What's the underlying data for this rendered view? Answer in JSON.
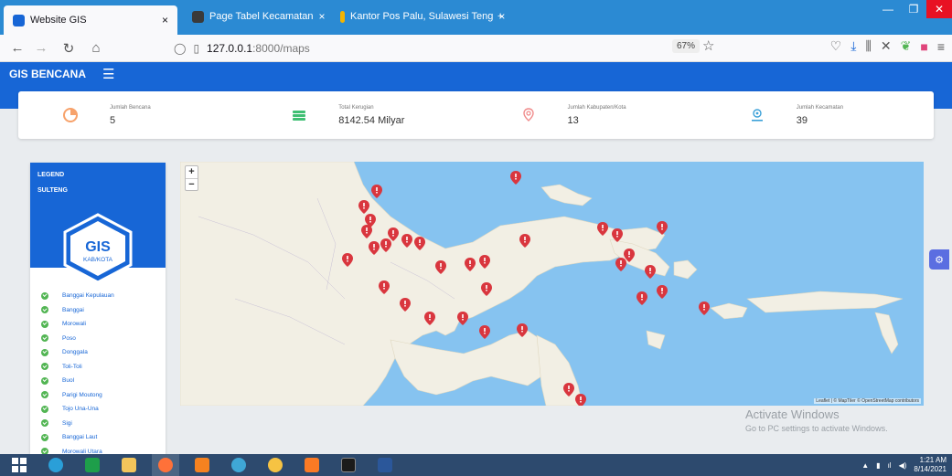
{
  "browser": {
    "tabs": [
      {
        "label": "Website GIS",
        "active": true,
        "favicon_color": "#1766d6"
      },
      {
        "label": "Page Tabel Kecamatan",
        "active": false,
        "favicon_color": "#3a3a3a"
      },
      {
        "label": "Kantor Pos Palu, Sulawesi Teng",
        "active": false,
        "favicon_color": "#f4b400"
      }
    ],
    "tab_close": "×",
    "new_tab": "+",
    "url_host": "127.0.0.1",
    "url_rest": ":8000/maps",
    "zoom": "67%"
  },
  "app": {
    "brand": "GIS BENCANA"
  },
  "stats": [
    {
      "label": "Jumlah Bencana",
      "value": "5",
      "icon": "pie-chart-icon",
      "color": "#f7a26b"
    },
    {
      "label": "Total Kerugian",
      "value": "8142.54 Milyar",
      "icon": "money-stack-icon",
      "color": "#3fbf73"
    },
    {
      "label": "Jumlah Kabupaten/Kota",
      "value": "13",
      "icon": "map-pin-outline-icon",
      "color": "#f08a8a"
    },
    {
      "label": "Jumlah Kecamatan",
      "value": "39",
      "icon": "location-icon",
      "color": "#3aa0d8"
    }
  ],
  "legend": {
    "title": "LEGEND",
    "subtitle": "SULTENG",
    "gis_title": "GIS",
    "gis_sub": "KAB/KOTA",
    "items": [
      "Banggai Kepulauan",
      "Banggai",
      "Morowali",
      "Poso",
      "Donggala",
      "Toli-Toli",
      "Buol",
      "Parigi Moutong",
      "Tojo Una-Una",
      "Sigi",
      "Banggai Laut",
      "Morowali Utara"
    ]
  },
  "map": {
    "zoom_in": "+",
    "zoom_out": "−",
    "attribution": "Leaflet | © MapTiler © OpenStreetMap contributors",
    "marker_color": "#d9363e",
    "sea_color": "#86c3f0",
    "land_color": "#f2efe4"
  },
  "watermark": {
    "line1": "Activate Windows",
    "line2": "Go to PC settings to activate Windows."
  },
  "taskbar": {
    "time": "1:21 AM",
    "date": "8/14/2021"
  }
}
